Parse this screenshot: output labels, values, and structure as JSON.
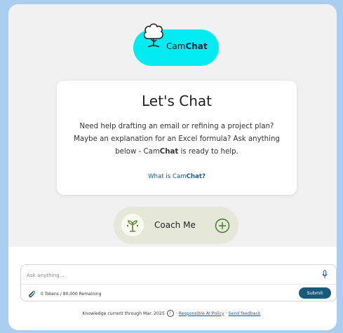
{
  "logo": {
    "name_prefix": "Cam",
    "name_bold": "Chat",
    "icon": "tree-icon",
    "color": "#00ecf2"
  },
  "card": {
    "title": "Let's Chat",
    "desc_line1": "Need help drafting an email or refining a project plan?",
    "desc_line2": "Maybe an explanation for an Excel formula? Ask anything",
    "desc_line3_before": "below - Cam",
    "desc_line3_bold": "Chat",
    "desc_line3_after": " is ready to help.",
    "link_prefix": "What is Cam",
    "link_bold": "Chat?"
  },
  "coach": {
    "label": "Coach Me",
    "icon": "sprout-icon",
    "add_icon": "plus-circle-icon"
  },
  "input": {
    "placeholder": "Ask anything...",
    "tokens": "0 Tokens / 80,000 Remaining",
    "submit_label": "Submit",
    "mic_icon": "microphone-icon",
    "attach_icon": "paperclip-icon"
  },
  "footer": {
    "knowledge": "Knowledge current through Mar. 2025",
    "info_icon": "info-icon",
    "sep1": "·",
    "policy_link": "Responsible AI Policy",
    "sep2": "·",
    "feedback_link": "Send feedback"
  },
  "colors": {
    "background": "#a9cef0",
    "accent": "#00ecf2",
    "submit": "#195a7c",
    "coach_bg": "#e5e8d8"
  }
}
